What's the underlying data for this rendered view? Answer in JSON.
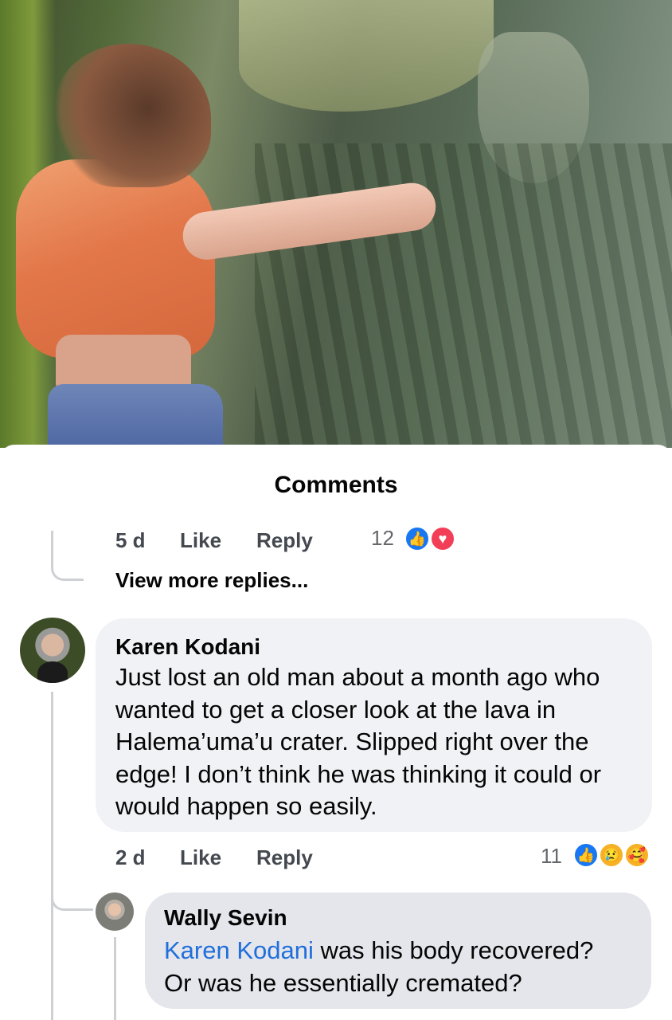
{
  "sheet": {
    "title": "Comments"
  },
  "previous_reply": {
    "time": "5 d",
    "like_label": "Like",
    "reply_label": "Reply",
    "reaction_count": "12"
  },
  "view_more": {
    "label": "View more replies..."
  },
  "comments": [
    {
      "author": "Karen Kodani",
      "lines": [
        "Just lost an old man about a month ago who",
        "wanted to get a closer look at the lava in",
        "Halema’uma’u crater.  Slipped right over the",
        "edge! I don’t think he was thinking it could or",
        "would happen so easily."
      ],
      "time": "2 d",
      "like_label": "Like",
      "reply_label": "Reply",
      "reaction_count": "11",
      "reactions": [
        "like-icon",
        "sad-icon",
        "care-icon"
      ]
    },
    {
      "author": "Wally Sevin",
      "mention": "Karen Kodani",
      "line1_rest": " was his body recovered?",
      "line2": "Or was he essentially cremated?"
    }
  ]
}
